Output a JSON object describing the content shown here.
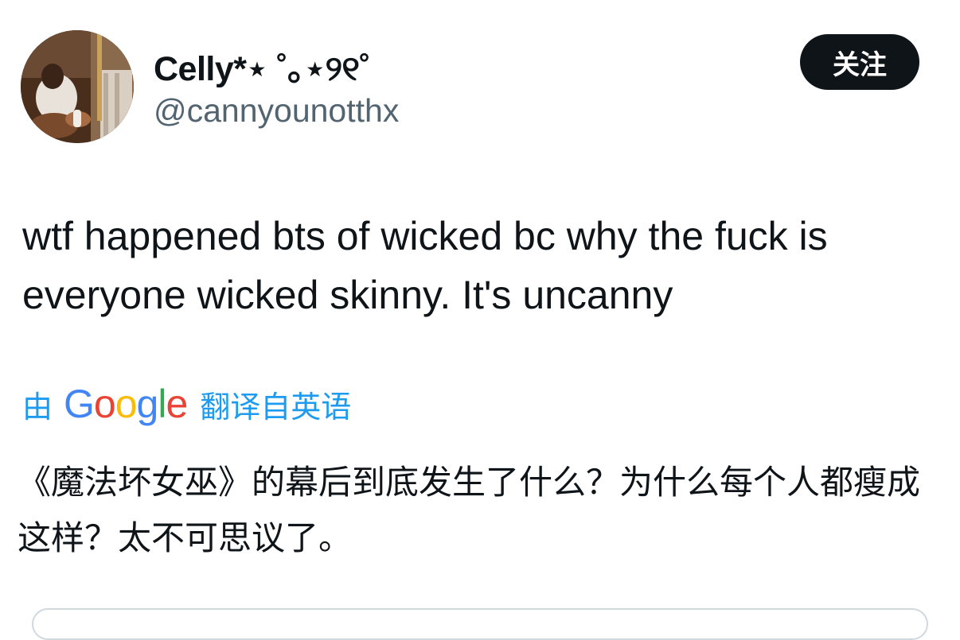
{
  "author": {
    "display_name": "Celly*⋆ ˚｡⋆୨୧˚",
    "handle": "@cannyounotthx",
    "avatar_icon": "profile-photo"
  },
  "follow_button": {
    "label": "关注"
  },
  "tweet": {
    "text": "wtf happened bts of wicked bc why the fuck is everyone wicked skinny. It's uncanny"
  },
  "translation": {
    "by_label": "由",
    "provider_logo": {
      "letters": [
        "G",
        "o",
        "o",
        "g",
        "l",
        "e"
      ],
      "colors": [
        "#4285f4",
        "#ea4335",
        "#fbbc05",
        "#4285f4",
        "#34a853",
        "#ea4335"
      ]
    },
    "from_label": "翻译自英语",
    "text": "《魔法坏女巫》的幕后到底发生了什么？为什么每个人都瘦成这样？太不可思议了。"
  },
  "colors": {
    "link": "#1d9bf0",
    "text_primary": "#0f1419",
    "text_secondary": "#536471",
    "button_bg": "#0f1419"
  }
}
